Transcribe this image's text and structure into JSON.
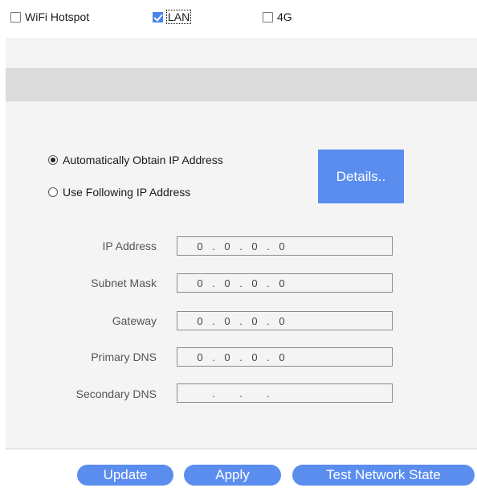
{
  "tabs": [
    {
      "label": "WiFi Hotspot",
      "checked": false
    },
    {
      "label": "LAN",
      "checked": true
    },
    {
      "label": "4G",
      "checked": false
    }
  ],
  "ip_mode": {
    "auto_label": "Automatically Obtain IP Address",
    "manual_label": "Use Following IP Address",
    "selected": "auto"
  },
  "details_button": "Details..",
  "fields": {
    "ip_address": {
      "label": "IP Address",
      "octets": [
        "0",
        "0",
        "0",
        "0"
      ]
    },
    "subnet_mask": {
      "label": "Subnet Mask",
      "octets": [
        "0",
        "0",
        "0",
        "0"
      ]
    },
    "gateway": {
      "label": "Gateway",
      "octets": [
        "0",
        "0",
        "0",
        "0"
      ]
    },
    "primary_dns": {
      "label": "Primary DNS",
      "octets": [
        "0",
        "0",
        "0",
        "0"
      ]
    },
    "secondary_dns": {
      "label": "Secondary DNS",
      "octets": [
        "",
        "",
        "",
        ""
      ]
    }
  },
  "buttons": {
    "update": "Update",
    "apply": "Apply",
    "test": "Test Network State"
  },
  "colors": {
    "accent": "#5b8def",
    "panel": "#f4f4f4",
    "bar": "#dcdcdc"
  }
}
